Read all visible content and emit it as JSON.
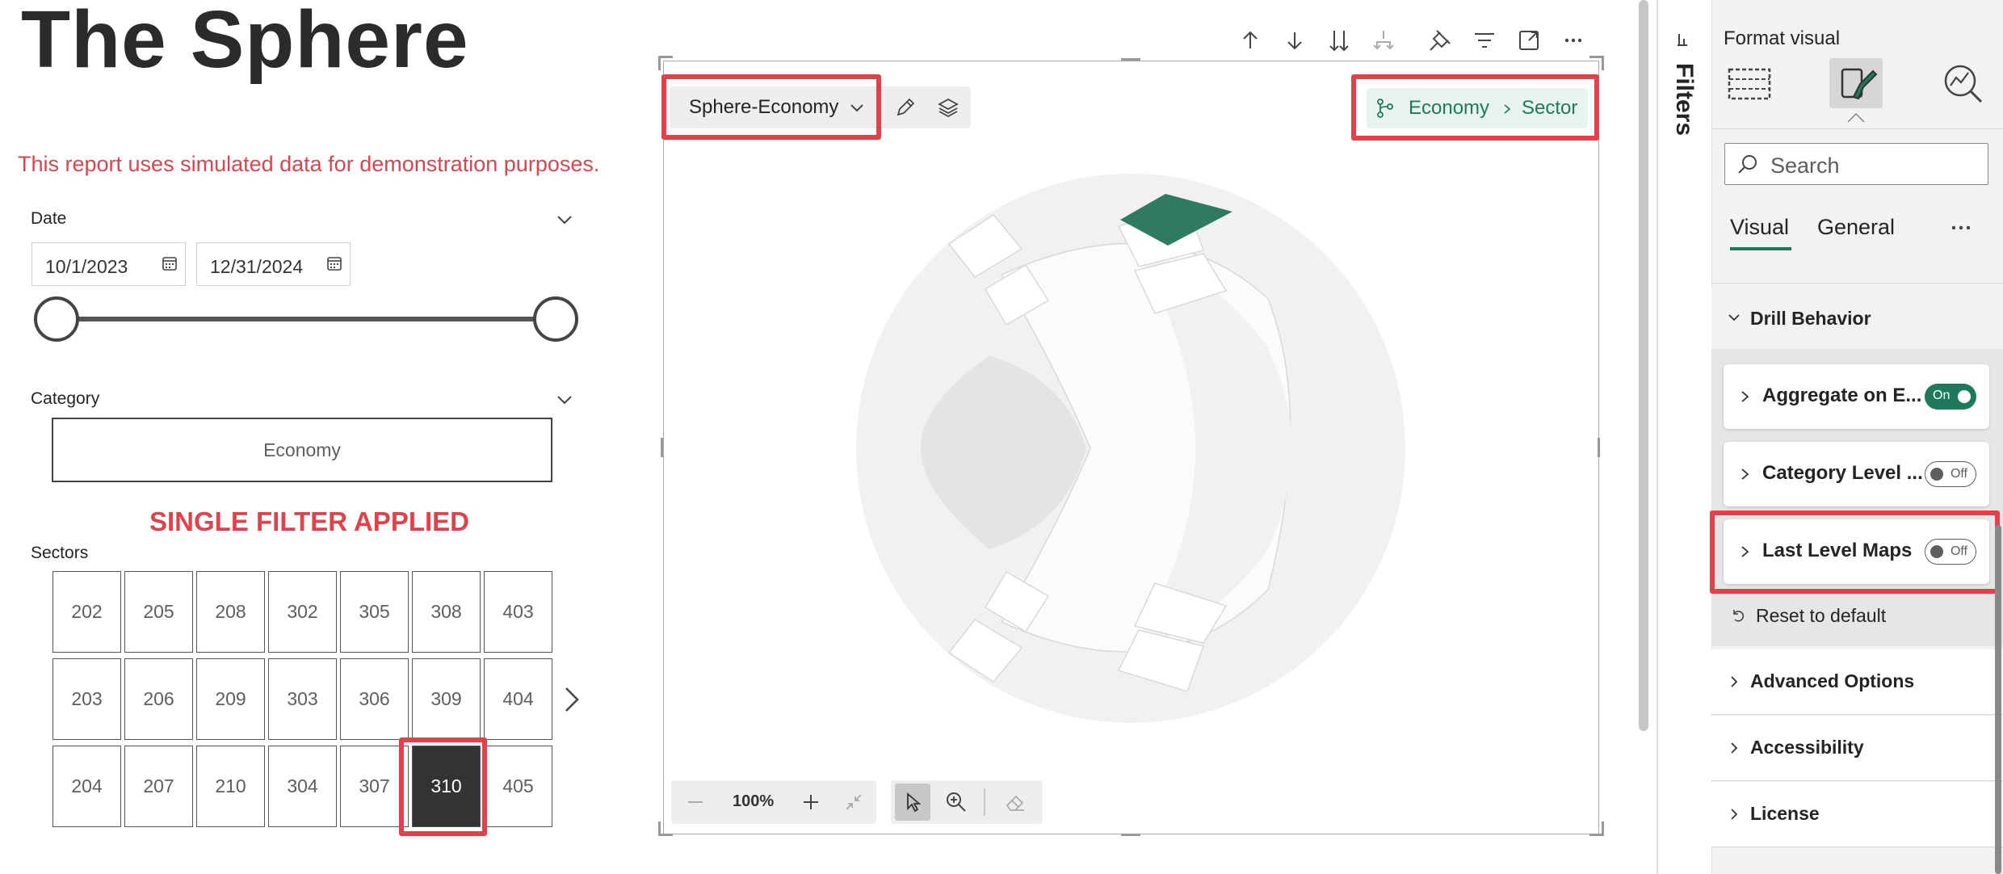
{
  "report": {
    "title": "The Sphere",
    "disclaimer": "This report uses simulated data for demonstration purposes.",
    "date_slicer": {
      "label": "Date",
      "start": "10/1/2023",
      "end": "12/31/2024"
    },
    "category_slicer": {
      "label": "Category",
      "value": "Economy"
    },
    "annotation": "SINGLE FILTER APPLIED",
    "sectors": {
      "label": "Sectors",
      "rows": [
        [
          "202",
          "205",
          "208",
          "302",
          "305",
          "308",
          "403"
        ],
        [
          "203",
          "206",
          "209",
          "303",
          "306",
          "309",
          "404"
        ],
        [
          "204",
          "207",
          "210",
          "304",
          "307",
          "310",
          "405"
        ]
      ],
      "selected": "310"
    }
  },
  "visual": {
    "map_selector": "Sphere-Economy",
    "breadcrumb": {
      "level1": "Economy",
      "level2": "Sector"
    },
    "zoom": "100%",
    "highlight_color": "#2e7a62"
  },
  "filters_pane": {
    "label": "Filters"
  },
  "format_pane": {
    "heading": "Format visual",
    "search_placeholder": "Search",
    "tabs": [
      "Visual",
      "General"
    ],
    "drill_behavior": {
      "title": "Drill Behavior",
      "items": [
        {
          "label": "Aggregate on E...",
          "toggle": "On"
        },
        {
          "label": "Category Level ...",
          "toggle": "Off"
        },
        {
          "label": "Last Level Maps",
          "toggle": "Off"
        }
      ],
      "reset": "Reset to default"
    },
    "sections": [
      "Advanced Options",
      "Accessibility",
      "License"
    ]
  }
}
